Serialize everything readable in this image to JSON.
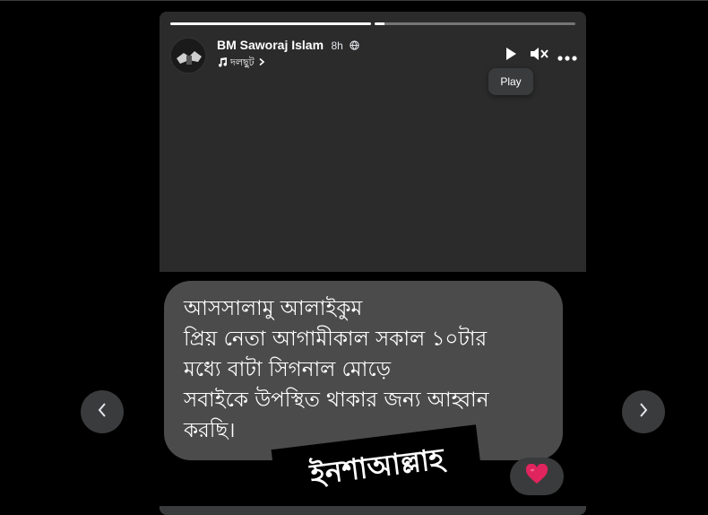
{
  "story": {
    "progress": [
      {
        "segment": 1,
        "fill": 1.0
      },
      {
        "segment": 2,
        "fill": 0.05
      }
    ],
    "author": {
      "name": "BM Saworaj Islam",
      "time": "8h",
      "privacy_icon": "globe-icon"
    },
    "music": {
      "icon": "music-note-icon",
      "label": "দলছুট"
    },
    "controls": {
      "play_icon": "play-icon",
      "mute_icon": "volume-muted-icon",
      "more_icon": "more-options-icon",
      "tooltip": "Play"
    },
    "bubble_text": "আসসালামু আলাইকুম\nপ্রিয় নেতা আগামীকাল সকাল ১০টার\nমধ্যে বাটা সিগনাল মোড়ে\n সবাইকে উপস্থিত থাকার জন্য আহ্বান\nকরছি।",
    "sticker_text": "ইনশাআল্লাহ",
    "reaction": "heart-reaction-icon"
  },
  "navigation": {
    "prev_icon": "chevron-left-icon",
    "next_icon": "chevron-right-icon"
  },
  "colors": {
    "background": "#000000",
    "card": "#242526",
    "bubble": "#4b4b4b",
    "control_bg": "#3a3b3c",
    "heart": "#e0245e"
  }
}
